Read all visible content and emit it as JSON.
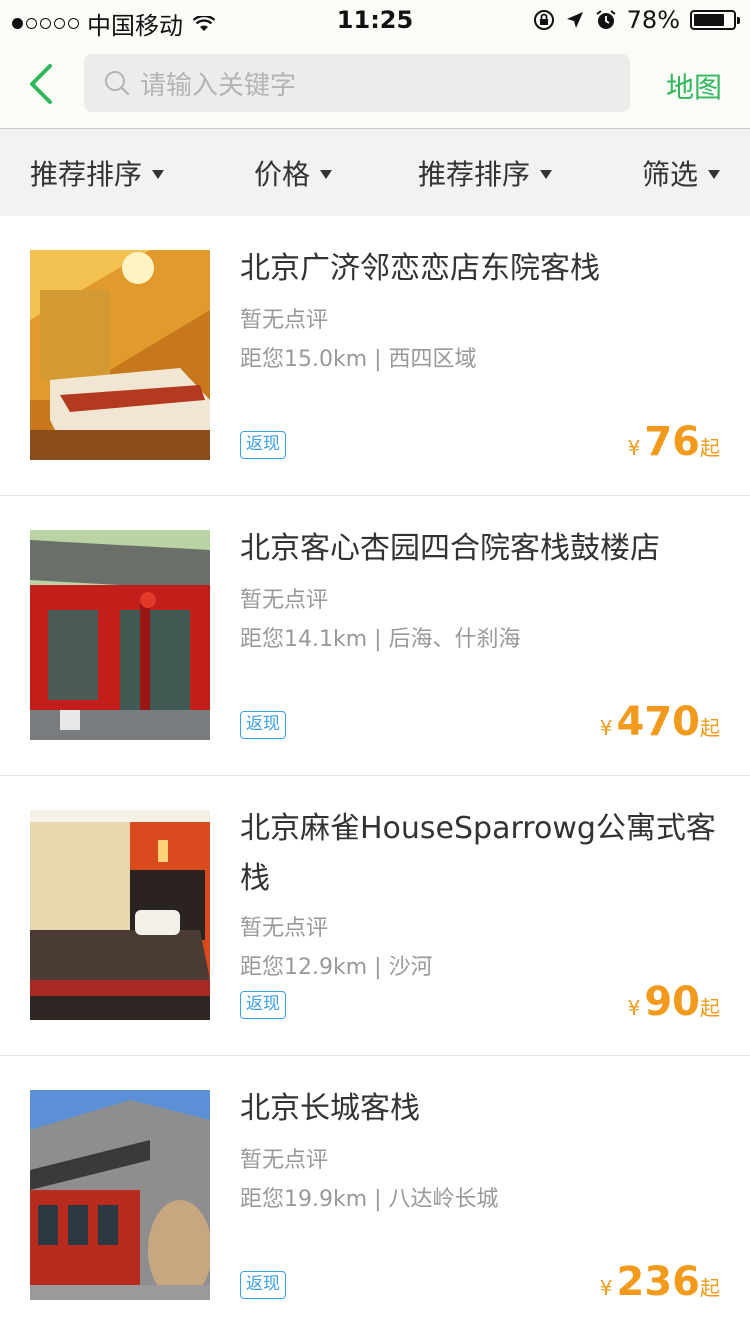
{
  "status_bar": {
    "carrier": "中国移动",
    "time": "11:25",
    "battery": "78%"
  },
  "nav": {
    "search_placeholder": "请输入关键字",
    "map_label": "地图"
  },
  "filters": [
    {
      "label": "推荐排序"
    },
    {
      "label": "价格"
    },
    {
      "label": "推荐排序"
    },
    {
      "label": "筛选"
    }
  ],
  "hotels": [
    {
      "name": "北京广济邻恋恋店东院客栈",
      "review": "暂无点评",
      "distance": "距您15.0km | 西四区域",
      "rebate": "返现",
      "currency": "¥",
      "price": "76",
      "price_suffix": "起"
    },
    {
      "name": "北京客心杏园四合院客栈鼓楼店",
      "review": "暂无点评",
      "distance": "距您14.1km | 后海、什刹海",
      "rebate": "返现",
      "currency": "¥",
      "price": "470",
      "price_suffix": "起"
    },
    {
      "name": "北京麻雀HouseSparrowg公寓式客栈",
      "review": "暂无点评",
      "distance": "距您12.9km | 沙河",
      "rebate": "返现",
      "currency": "¥",
      "price": "90",
      "price_suffix": "起"
    },
    {
      "name": "北京长城客栈",
      "review": "暂无点评",
      "distance": "距您19.9km | 八达岭长城",
      "rebate": "返现",
      "currency": "¥",
      "price": "236",
      "price_suffix": "起"
    }
  ],
  "colors": {
    "accent_green": "#2fb85c",
    "price_orange": "#f39a1d",
    "rebate_blue": "#3aa0e8"
  }
}
